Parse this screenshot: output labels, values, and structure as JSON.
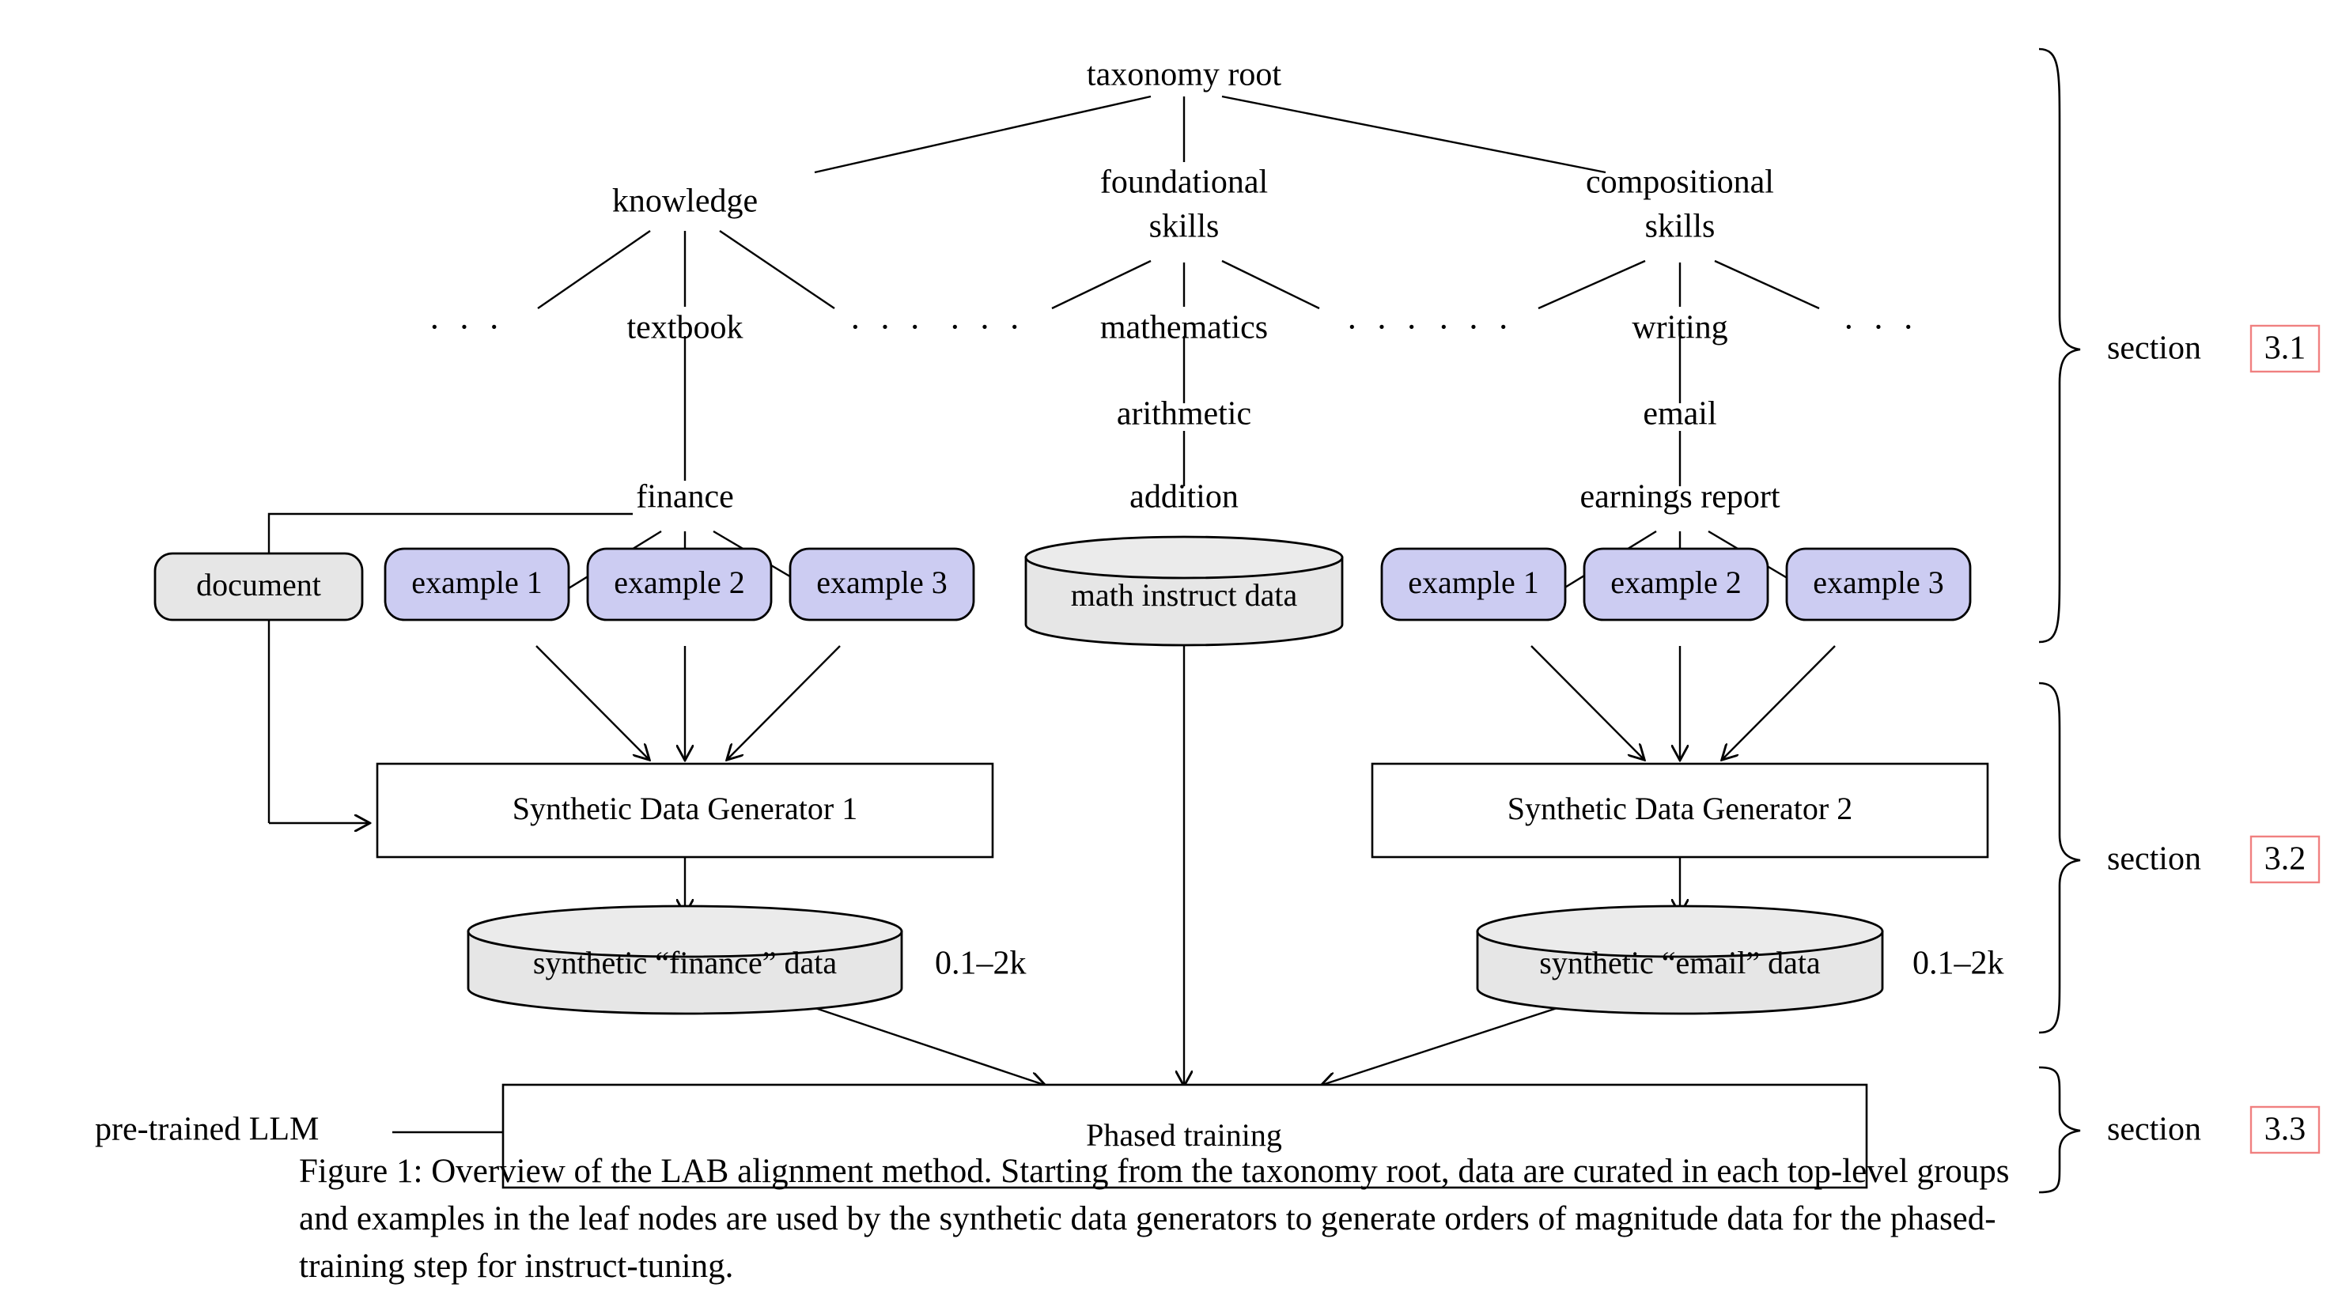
{
  "figure": {
    "caption": "Figure 1: Overview of the LAB alignment method. Starting from the taxonomy root, data are curated in each top-level groups and examples in the leaf nodes are used by the synthetic data generators to generate orders of magnitude data for the phased-training step for instruct-tuning."
  },
  "taxonomy": {
    "root": "taxonomy root",
    "level1": [
      {
        "label": "knowledge",
        "line2": ""
      },
      {
        "label": "foundational",
        "line2": "skills"
      },
      {
        "label": "compositional",
        "line2": "skills"
      }
    ],
    "level2": {
      "knowledge_children": [
        "…",
        "textbook",
        "…",
        "…"
      ],
      "foundational_children": [
        "mathematics",
        "…",
        "…"
      ],
      "compositional_children": [
        "writing",
        "…"
      ]
    },
    "knowledge_path": [
      "textbook",
      "finance"
    ],
    "foundational_path": [
      "mathematics",
      "arithmetic",
      "addition"
    ],
    "compositional_path": [
      "writing",
      "email",
      "earnings report"
    ],
    "dots": "· · ·"
  },
  "leaves": {
    "document": "document",
    "finance_examples": [
      "example 1",
      "example 2",
      "example 3"
    ],
    "email_examples": [
      "example 1",
      "example 2",
      "example 3"
    ],
    "math_data": "math instruct data"
  },
  "generators": {
    "gen1": "Synthetic Data Generator 1",
    "gen2": "Synthetic Data Generator 2"
  },
  "outputs": {
    "finance_data": "synthetic “finance” data",
    "finance_count": "0.1–2k",
    "email_data": "synthetic “email” data",
    "email_count": "0.1–2k"
  },
  "training": {
    "input_label": "pre-trained LLM",
    "box_label": "Phased training"
  },
  "sections": [
    {
      "prefix": "section",
      "ref": "3.1"
    },
    {
      "prefix": "section",
      "ref": "3.2"
    },
    {
      "prefix": "section",
      "ref": "3.3"
    }
  ],
  "colors": {
    "example_fill": "#CCCCF2",
    "document_fill": "#E6E6E6",
    "cylinder_fill": "#E6E6E6",
    "ref_box_stroke": "#F08080",
    "line": "#000000",
    "background": "#FFFFFF"
  }
}
